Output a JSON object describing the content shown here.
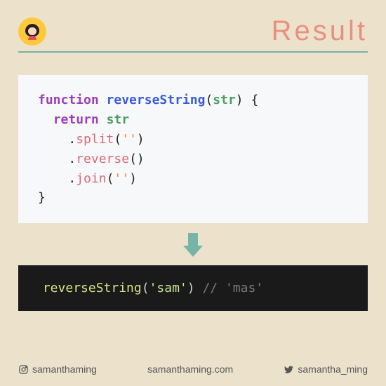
{
  "header": {
    "title": "Result"
  },
  "code_light": {
    "kw_function": "function",
    "fn_name": "reverseString",
    "param": "str",
    "open_brace": " {",
    "kw_return": "return",
    "var_str": "str",
    "method_split": "split",
    "method_reverse": "reverse",
    "method_join": "join",
    "empty_str": "''",
    "close_brace": "}"
  },
  "code_dark": {
    "call_fn": "reverseString",
    "call_arg": "'sam'",
    "comment": "// 'mas'"
  },
  "footer": {
    "instagram": "samanthaming",
    "website": "samanthaming.com",
    "twitter": "samantha_ming"
  }
}
